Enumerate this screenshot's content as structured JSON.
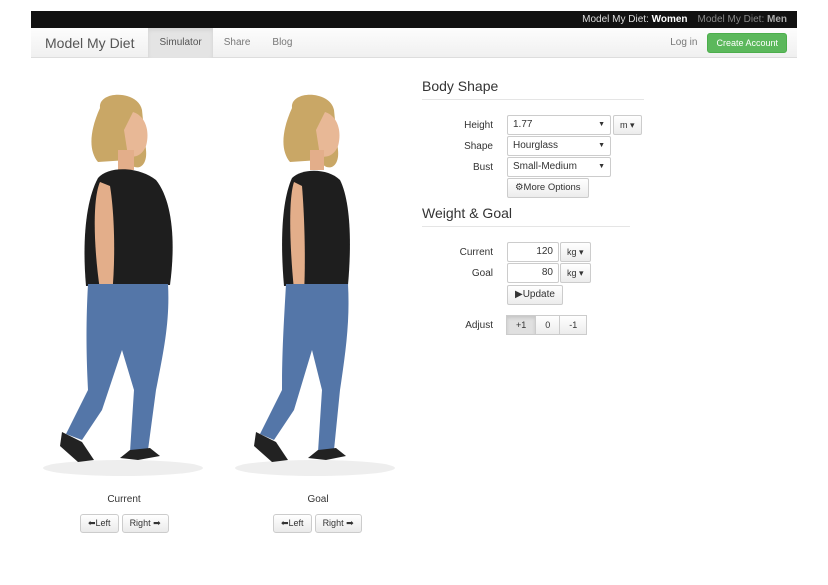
{
  "topbar": {
    "women_prefix": "Model My Diet: ",
    "women_bold": "Women",
    "men_prefix": "Model My Diet: ",
    "men_bold": "Men"
  },
  "navbar": {
    "brand": "Model My Diet",
    "items": [
      "Simulator",
      "Share",
      "Blog"
    ],
    "active": "Simulator",
    "login": "Log in",
    "create_account": "Create Account"
  },
  "figures": [
    {
      "caption": "Current",
      "left_label": "Left",
      "right_label": "Right"
    },
    {
      "caption": "Goal",
      "left_label": "Left",
      "right_label": "Right"
    }
  ],
  "body_shape": {
    "title": "Body Shape",
    "height_label": "Height",
    "height_value": "1.77",
    "height_unit": "m",
    "shape_label": "Shape",
    "shape_value": "Hourglass",
    "bust_label": "Bust",
    "bust_value": "Small-Medium",
    "more_options": "More Options"
  },
  "weight_goal": {
    "title": "Weight & Goal",
    "current_label": "Current",
    "current_value": "120",
    "current_unit": "kg",
    "goal_label": "Goal",
    "goal_value": "80",
    "goal_unit": "kg",
    "update": "Update",
    "adjust_label": "Adjust",
    "adjust_options": [
      "+1",
      "0",
      "-1"
    ],
    "adjust_active": "+1"
  },
  "colors": {
    "accent_green": "#5cb85c",
    "topbar_bg": "#111111",
    "shirt": "#1e1e1e",
    "jeans": "#5476a8",
    "hair": "#c9a766",
    "skin": "#e8b896"
  }
}
